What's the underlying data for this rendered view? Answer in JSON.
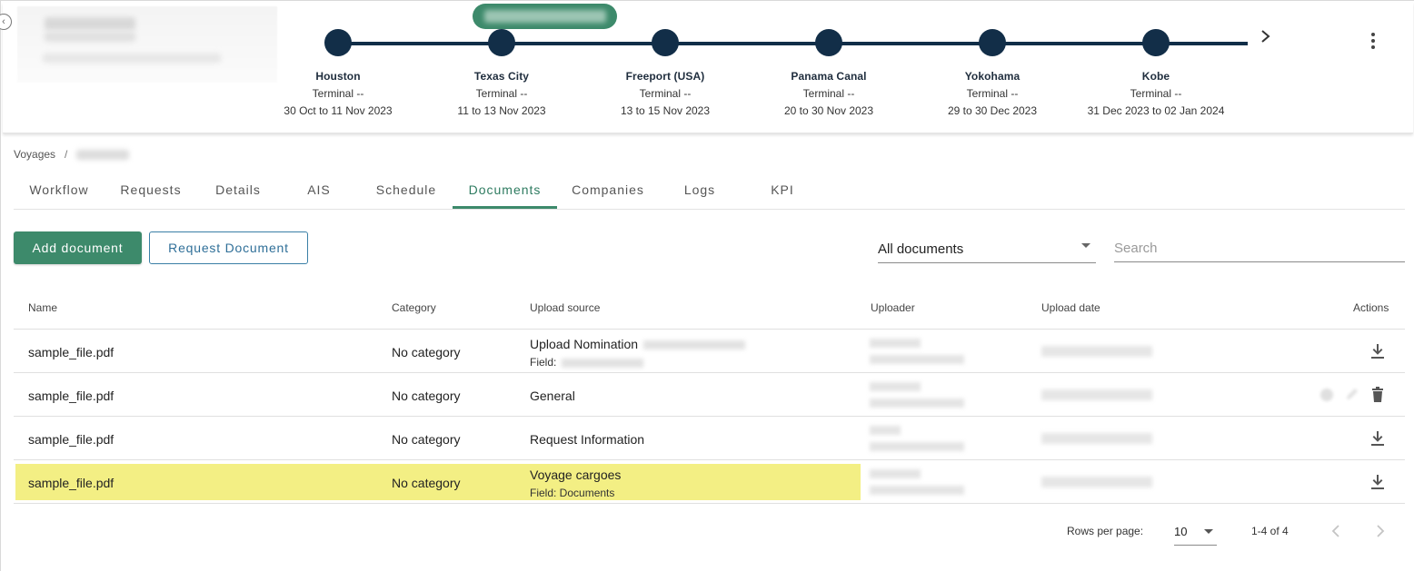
{
  "current_port_label": "",
  "timeline": {
    "stops": [
      {
        "port": "Houston",
        "terminal": "Terminal --",
        "dates": "30 Oct to 11 Nov 2023"
      },
      {
        "port": "Texas City",
        "terminal": "Terminal --",
        "dates": "11 to 13 Nov 2023"
      },
      {
        "port": "Freeport (USA)",
        "terminal": "Terminal --",
        "dates": "13 to 15 Nov 2023"
      },
      {
        "port": "Panama Canal",
        "terminal": "Terminal --",
        "dates": "20 to 30 Nov 2023"
      },
      {
        "port": "Yokohama",
        "terminal": "Terminal --",
        "dates": "29 to 30 Dec 2023"
      },
      {
        "port": "Kobe",
        "terminal": "Terminal --",
        "dates": "31 Dec 2023 to 02 Jan 2024"
      }
    ]
  },
  "breadcrumb": {
    "root": "Voyages",
    "separator": "/"
  },
  "tabs": [
    {
      "label": "Workflow",
      "active": false
    },
    {
      "label": "Requests",
      "active": false
    },
    {
      "label": "Details",
      "active": false
    },
    {
      "label": "AIS",
      "active": false
    },
    {
      "label": "Schedule",
      "active": false
    },
    {
      "label": "Documents",
      "active": true
    },
    {
      "label": "Companies",
      "active": false
    },
    {
      "label": "Logs",
      "active": false
    },
    {
      "label": "KPI",
      "active": false
    }
  ],
  "toolbar": {
    "add_label": "Add document",
    "request_label": "Request Document",
    "filter_value": "All documents",
    "search_placeholder": "Search"
  },
  "table": {
    "headers": {
      "name": "Name",
      "category": "Category",
      "source": "Upload source",
      "uploader": "Uploader",
      "date": "Upload date",
      "actions": "Actions"
    },
    "rows": [
      {
        "name": "sample_file.pdf",
        "category": "No category",
        "source": "Upload Nomination",
        "field": "Field:",
        "highlighted": false,
        "actions": [
          "download"
        ]
      },
      {
        "name": "sample_file.pdf",
        "category": "No category",
        "source": "General",
        "field": "",
        "highlighted": false,
        "actions": [
          "delete"
        ]
      },
      {
        "name": "sample_file.pdf",
        "category": "No category",
        "source": "Request Information",
        "field": "",
        "highlighted": false,
        "actions": [
          "download"
        ]
      },
      {
        "name": "sample_file.pdf",
        "category": "No category",
        "source": "Voyage cargoes",
        "field": "Field: Documents",
        "highlighted": true,
        "actions": [
          "download"
        ]
      }
    ]
  },
  "pagination": {
    "rows_label": "Rows per page:",
    "rows_value": "10",
    "range": "1-4 of 4"
  },
  "colors": {
    "accent": "#3d8a6b",
    "timeline": "#122e48",
    "highlight": "#f3ef84",
    "outline_button": "#3a7fa6"
  }
}
